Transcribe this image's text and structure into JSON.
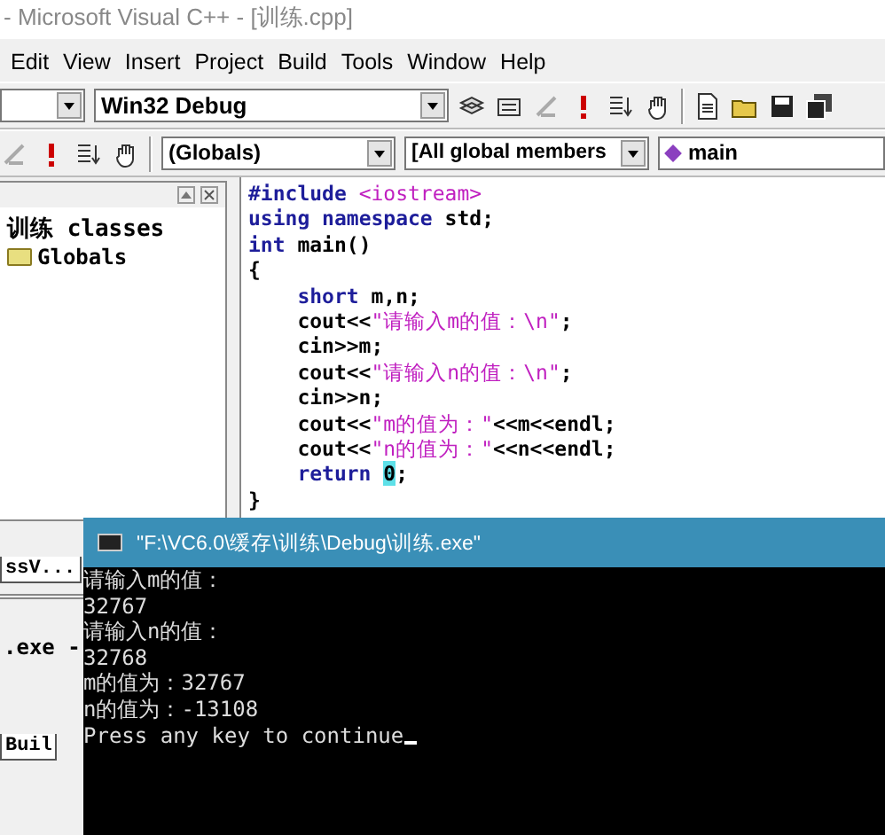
{
  "window": {
    "title": "- Microsoft Visual C++ - [训练.cpp]"
  },
  "menu": [
    {
      "label": "Edit"
    },
    {
      "label": "View"
    },
    {
      "label": "Insert"
    },
    {
      "label": "Project"
    },
    {
      "label": "Build"
    },
    {
      "label": "Tools"
    },
    {
      "label": "Window"
    },
    {
      "label": "Help"
    }
  ],
  "toolbar": {
    "config_combo": "Win32 Debug"
  },
  "wizard_bar": {
    "class_combo": "(Globals)",
    "filter_combo": "[All global members",
    "member_combo": "main"
  },
  "class_view": {
    "tree": [
      {
        "label": "训练 classes",
        "children": [
          {
            "label": "Globals"
          }
        ]
      }
    ],
    "tab": "ssV..."
  },
  "output": {
    "line": ".exe -",
    "tab": "Buil"
  },
  "editor": {
    "lines": [
      [
        {
          "kind": "keyword",
          "text": "#include"
        },
        {
          "kind": "string",
          "text": " <iostream>"
        }
      ],
      [
        {
          "kind": "keyword",
          "text": "using"
        },
        {
          "kind": "keyword",
          "text": " namespace"
        },
        {
          "kind": "plain",
          "text": " std;"
        }
      ],
      [
        {
          "kind": "keyword",
          "text": "int"
        },
        {
          "kind": "plain",
          "text": " main()"
        }
      ],
      [
        {
          "kind": "plain",
          "text": "{"
        }
      ],
      [
        {
          "kind": "keyword",
          "text": "    short"
        },
        {
          "kind": "plain",
          "text": " m,n;"
        }
      ],
      [
        {
          "kind": "plain",
          "text": "    cout<<"
        },
        {
          "kind": "string",
          "text": "\"请输入m的值：\\n\""
        },
        {
          "kind": "plain",
          "text": ";"
        }
      ],
      [
        {
          "kind": "plain",
          "text": "    cin>>m;"
        }
      ],
      [
        {
          "kind": "plain",
          "text": "    cout<<"
        },
        {
          "kind": "string",
          "text": "\"请输入n的值：\\n\""
        },
        {
          "kind": "plain",
          "text": ";"
        }
      ],
      [
        {
          "kind": "plain",
          "text": "    cin>>n;"
        }
      ],
      [
        {
          "kind": "plain",
          "text": "    cout<<"
        },
        {
          "kind": "string",
          "text": "\"m的值为：\""
        },
        {
          "kind": "plain",
          "text": "<<m<<endl;"
        }
      ],
      [
        {
          "kind": "plain",
          "text": "    cout<<"
        },
        {
          "kind": "string",
          "text": "\"n的值为：\""
        },
        {
          "kind": "plain",
          "text": "<<n<<endl;"
        }
      ],
      [
        {
          "kind": "keyword",
          "text": "    return "
        },
        {
          "kind": "cursor",
          "text": "0"
        },
        {
          "kind": "plain",
          "text": ";"
        }
      ],
      [
        {
          "kind": "plain",
          "text": "}"
        }
      ]
    ]
  },
  "console": {
    "title": "\"F:\\VC6.0\\缓存\\训练\\Debug\\训练.exe\"",
    "lines": [
      "请输入m的值：",
      "32767",
      "请输入n的值：",
      "32768",
      "m的值为：32767",
      "n的值为：-13108",
      "Press any key to continue"
    ]
  }
}
